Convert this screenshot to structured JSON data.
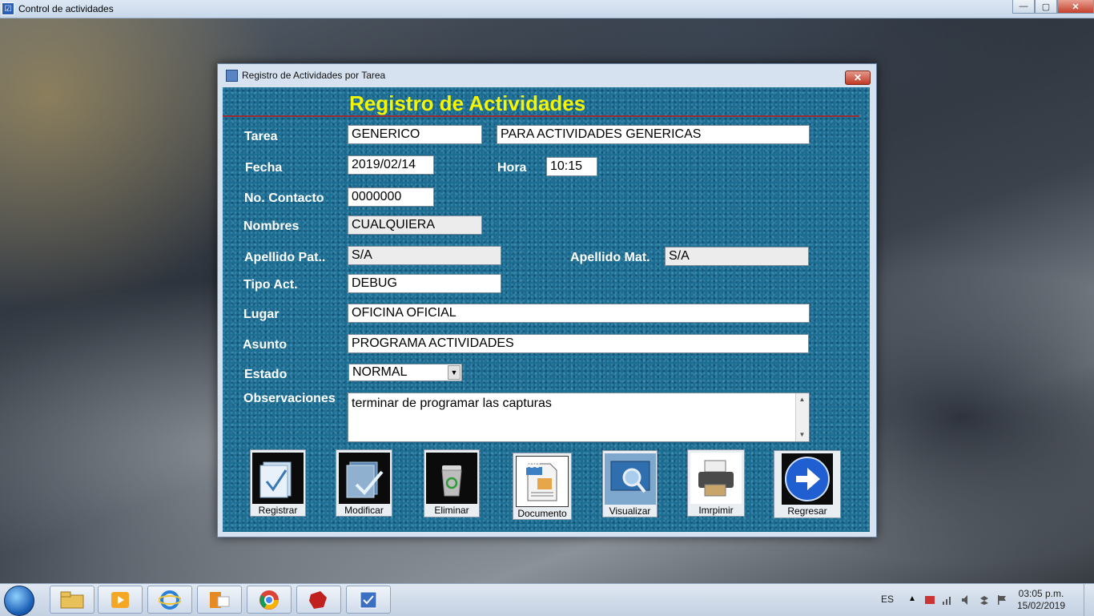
{
  "app": {
    "title": "Control de actividades"
  },
  "window_controls": {
    "minimize": "—",
    "maximize": "▢",
    "close": "✕"
  },
  "dialog": {
    "title": "Registro de Actividades por Tarea",
    "close": "✕",
    "heading": "Registro de Actividades"
  },
  "form": {
    "tarea": {
      "label": "Tarea",
      "code": "GENERICO",
      "description": "PARA ACTIVIDADES GENERICAS"
    },
    "fecha": {
      "label": "Fecha",
      "value": "2019/02/14"
    },
    "hora": {
      "label": "Hora",
      "value": "10:15"
    },
    "contacto": {
      "label": "No. Contacto",
      "value": "0000000"
    },
    "nombres": {
      "label": "Nombres",
      "value": "CUALQUIERA"
    },
    "apellido_pat": {
      "label": "Apellido Pat..",
      "value": "S/A"
    },
    "apellido_mat": {
      "label": "Apellido Mat.",
      "value": "S/A"
    },
    "tipo_act": {
      "label": "Tipo Act.",
      "value": "DEBUG"
    },
    "lugar": {
      "label": "Lugar",
      "value": "OFICINA OFICIAL"
    },
    "asunto": {
      "label": "Asunto",
      "value": "PROGRAMA ACTIVIDADES"
    },
    "estado": {
      "label": "Estado",
      "value": "NORMAL",
      "arrow": "▼"
    },
    "observaciones": {
      "label": "Observaciones",
      "value": "terminar de programar las capturas",
      "up": "▲",
      "down": "▼"
    }
  },
  "buttons": {
    "registrar": "Registrar",
    "modificar": "Modificar",
    "eliminar": "Eliminar",
    "documento": "Documento",
    "doc_badge": "DOC",
    "visualizar": "Visualizar",
    "imprimir": "Imrpimir",
    "regresar": "Regresar"
  },
  "taskbar": {
    "language": "ES",
    "time": "03:05 p.m.",
    "date": "15/02/2019",
    "items": [
      "file-explorer-icon",
      "media-player-icon",
      "internet-explorer-icon",
      "outlook-icon",
      "chrome-icon",
      "puzzle-app-icon",
      "control-actividades-icon"
    ]
  },
  "colors": {
    "panel": "#1d6d92",
    "heading": "#f5f500",
    "rule": "#9b2a32"
  }
}
